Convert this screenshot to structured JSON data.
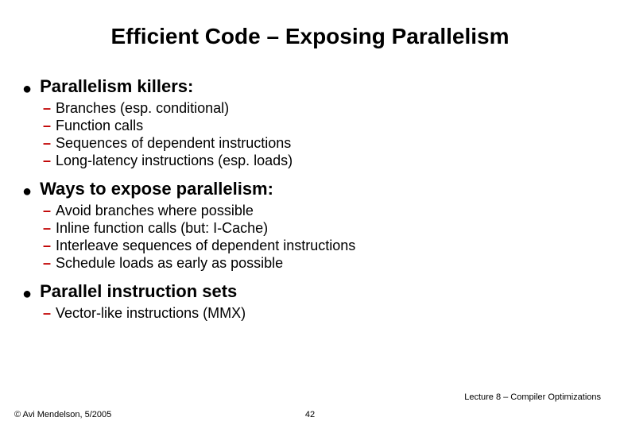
{
  "title": "Efficient Code – Exposing Parallelism",
  "sections": [
    {
      "heading": "Parallelism killers:",
      "items": [
        "Branches (esp. conditional)",
        "Function calls",
        "Sequences of dependent instructions",
        "Long-latency instructions (esp. loads)"
      ]
    },
    {
      "heading": "Ways to expose parallelism:",
      "items": [
        "Avoid branches where possible",
        "Inline function calls (but: I-Cache)",
        "Interleave sequences of dependent instructions",
        "Schedule loads as early as possible"
      ]
    },
    {
      "heading": "Parallel instruction sets",
      "items": [
        "Vector-like instructions (MMX)"
      ]
    }
  ],
  "footer": {
    "lecture": "Lecture 8 – Compiler Optimizations",
    "copyright": "© Avi Mendelson, 5/2005",
    "page": "42"
  }
}
